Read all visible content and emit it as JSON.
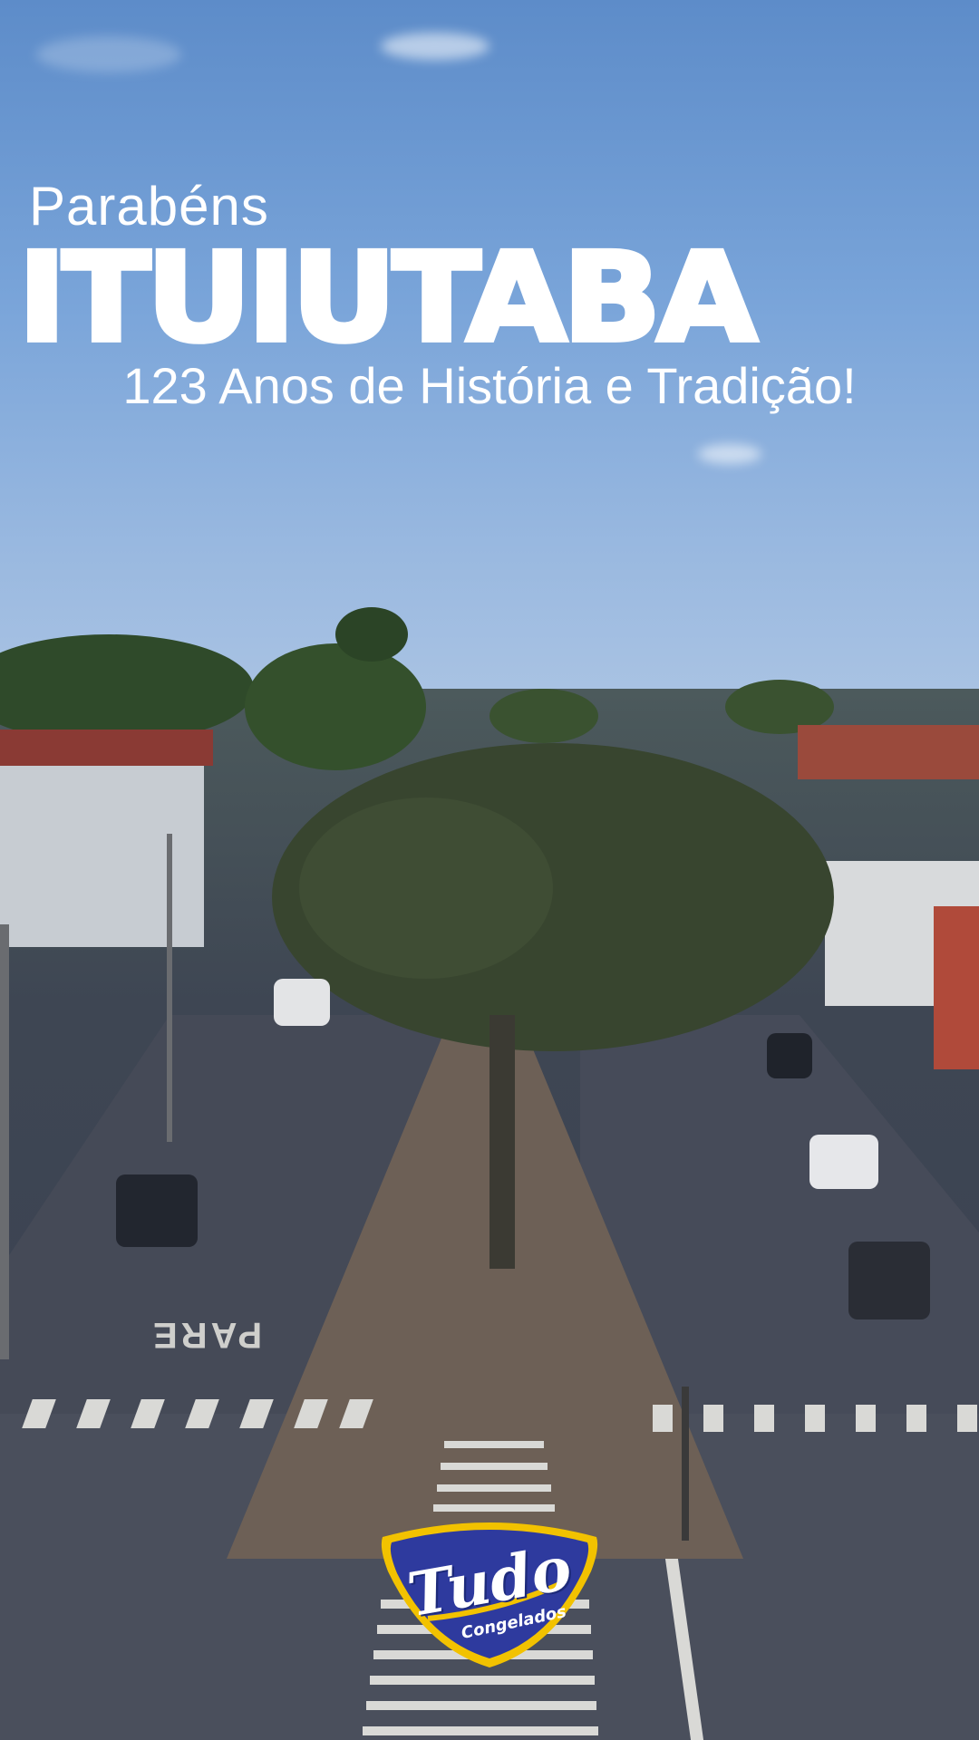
{
  "headline": {
    "greeting": "Parabéns",
    "city": "ITUIUTABA",
    "tagline": "123 Anos de História e Tradição!"
  },
  "logo": {
    "main": "Tudo",
    "sub": "Congelados",
    "colors": {
      "fill": "#2e3a9e",
      "rim": "#f2c200"
    }
  },
  "road_marking": "PARE"
}
